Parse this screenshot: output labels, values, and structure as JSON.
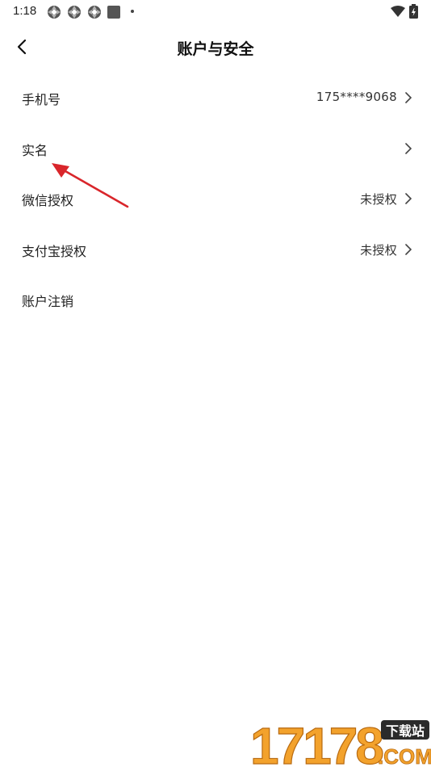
{
  "status_bar": {
    "time": "1:18",
    "icons": [
      "notification-icon",
      "notification-icon",
      "notification-icon",
      "stop-icon",
      "dot-icon",
      "wifi-icon",
      "battery-icon"
    ]
  },
  "header": {
    "title": "账户与安全",
    "back_icon": "chevron-left-icon"
  },
  "rows": [
    {
      "label": "手机号",
      "value": "175****9068",
      "chevron": true
    },
    {
      "label": "实名",
      "value": "",
      "chevron": true
    },
    {
      "label": "微信授权",
      "value": "未授权",
      "chevron": true
    },
    {
      "label": "支付宝授权",
      "value": "未授权",
      "chevron": true
    },
    {
      "label": "账户注销",
      "value": "",
      "chevron": false
    }
  ],
  "annotation": {
    "color": "#d9262b"
  },
  "watermark": {
    "text": "17178 下载站 .COM",
    "colors": [
      "#f3a22c",
      "#2b2b2b"
    ]
  }
}
